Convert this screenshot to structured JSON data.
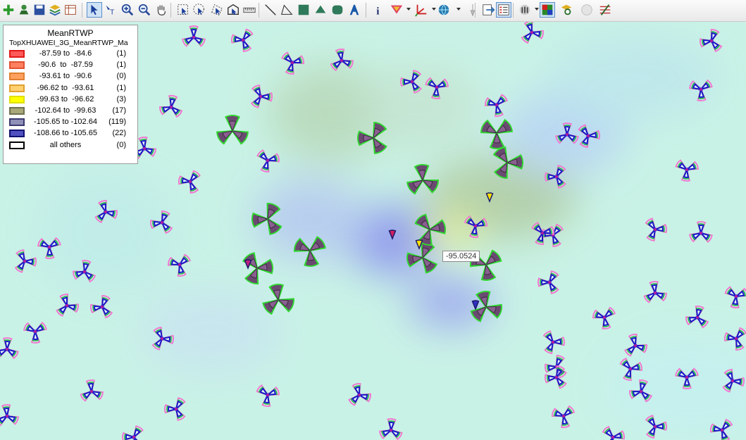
{
  "toolbar": {
    "items": [
      {
        "name": "add-layer-icon"
      },
      {
        "name": "add-data-icon"
      },
      {
        "name": "save-icon"
      },
      {
        "name": "layers-icon"
      },
      {
        "name": "table-icon"
      },
      {
        "name": "select-arrow-icon",
        "active": true
      },
      {
        "name": "identify-text-icon"
      },
      {
        "name": "zoom-in-icon"
      },
      {
        "name": "zoom-out-icon"
      },
      {
        "name": "pan-hand-icon"
      },
      {
        "name": "select-rectangle-icon"
      },
      {
        "name": "select-circle-icon"
      },
      {
        "name": "select-polygon-icon"
      },
      {
        "name": "select-region-icon"
      },
      {
        "name": "ruler-icon"
      },
      {
        "name": "line-draw-icon"
      },
      {
        "name": "polyline-draw-icon"
      },
      {
        "name": "rectangle-draw-icon"
      },
      {
        "name": "polygon-draw-icon"
      },
      {
        "name": "ellipse-draw-icon"
      },
      {
        "name": "text-draw-icon"
      },
      {
        "name": "info-icon"
      },
      {
        "name": "filter-icon"
      },
      {
        "name": "axis-icon"
      },
      {
        "name": "globe-icon"
      },
      {
        "name": "pin-icon"
      },
      {
        "name": "export-icon"
      },
      {
        "name": "legend-icon",
        "active": true
      },
      {
        "name": "antenna-icon"
      },
      {
        "name": "color-map-icon",
        "active": true
      },
      {
        "name": "layer-search-icon"
      },
      {
        "name": "disabled-circle-icon"
      },
      {
        "name": "edit-settings-icon"
      }
    ]
  },
  "legend": {
    "title": "MeanRTWP",
    "subtitle": "TopXHUAWEI_3G_MeanRTWP_Ma",
    "rows": [
      {
        "range": "-87.59 to  -84.6",
        "count": "(1)",
        "fill": "#ff5a5a",
        "border": "#e01818"
      },
      {
        "range": "-90.6  to  -87.59",
        "count": "(1)",
        "fill": "#ff8060",
        "border": "#e05030"
      },
      {
        "range": "-93.61 to  -90.6",
        "count": "(0)",
        "fill": "#ffa060",
        "border": "#e08030"
      },
      {
        "range": "-96.62 to  -93.61",
        "count": "(1)",
        "fill": "#ffd070",
        "border": "#e0a030"
      },
      {
        "range": "-99.63 to  -96.62",
        "count": "(3)",
        "fill": "#ffff00",
        "border": "#e0e000"
      },
      {
        "range": "-102.64 to  -99.63",
        "count": "(17)",
        "fill": "#a8a878",
        "border": "#707050"
      },
      {
        "range": "-105.65 to -102.64",
        "count": "(119)",
        "fill": "#9090b8",
        "border": "#3a3a70"
      },
      {
        "range": "-108.66 to -105.65",
        "count": "(22)",
        "fill": "#5050c0",
        "border": "#101070"
      },
      {
        "range": "all others",
        "count": "(0)",
        "fill": "#ffffff",
        "border": "#000000"
      }
    ]
  },
  "tooltip": {
    "value": "-95.0524"
  },
  "colors": {
    "map_background": "#c9f2e6",
    "dark_sector": "#6a4a70",
    "blue_sector": "#1818c8",
    "green_outline": "#2fd82f",
    "magenta_sector": "#b01ca0"
  }
}
